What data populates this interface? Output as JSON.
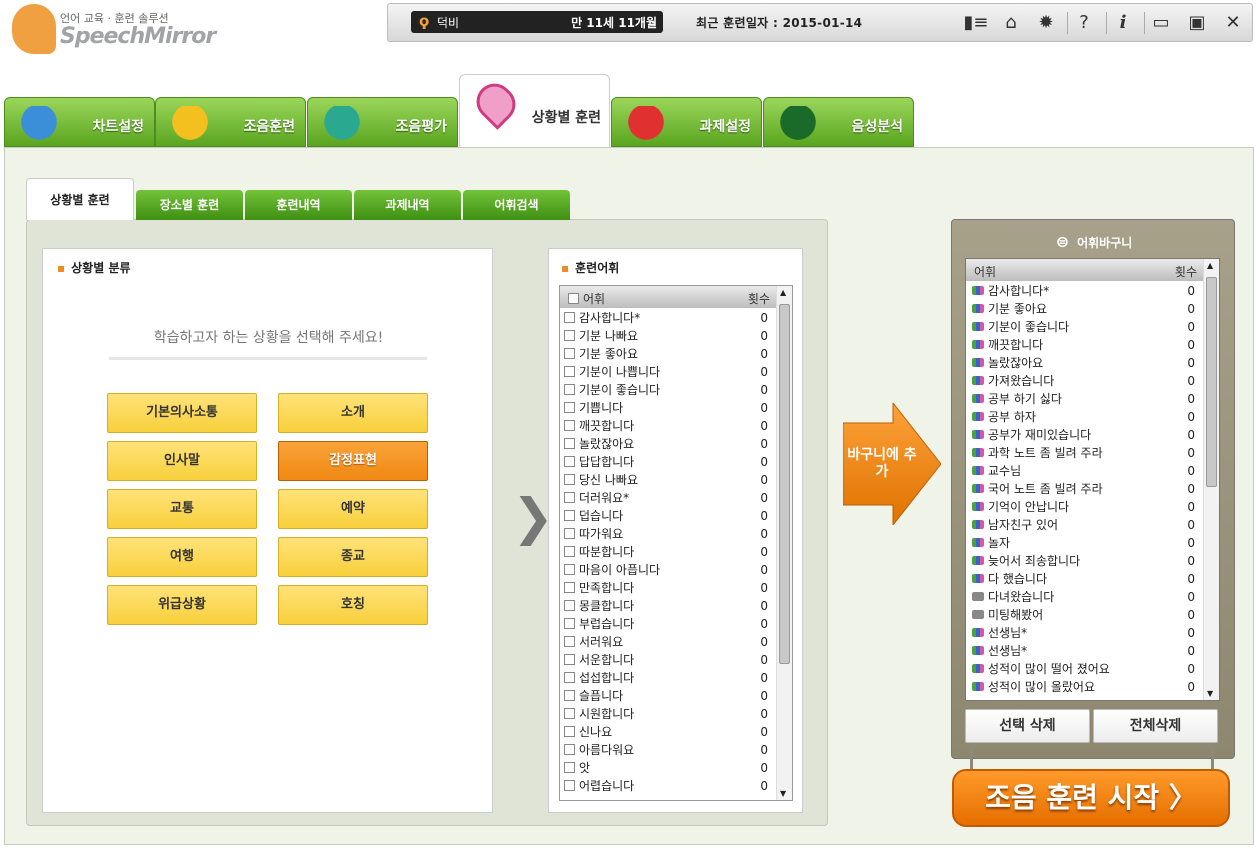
{
  "logo": {
    "sub": "언어 교육 · 훈련 솔루션",
    "main": "SpeechMirror"
  },
  "user": {
    "name": "덕비",
    "age": "만 11세 11개월",
    "last_training": "최근 훈련일자 : 2015-01-14"
  },
  "toolbar_icons": [
    "id-card-icon",
    "home-icon",
    "gear-icon",
    "help-icon",
    "info-icon",
    "minimize-icon",
    "restore-icon",
    "close-icon"
  ],
  "toolbar_glyphs": [
    "▮≡",
    "⌂",
    "✹",
    "?",
    "i",
    "▭",
    "▣",
    "✕"
  ],
  "main_tabs": [
    {
      "label": "차트설정",
      "icon": "chart-person-icon"
    },
    {
      "label": "조음훈련",
      "icon": "speaking-face-icon"
    },
    {
      "label": "조음평가",
      "icon": "ox-icon"
    },
    {
      "label": "상황별 훈련",
      "icon": "map-pin-icon"
    },
    {
      "label": "과제설정",
      "icon": "rubiks-cube-icon"
    },
    {
      "label": "음성분석",
      "icon": "waveform-monitor-icon"
    }
  ],
  "sub_tabs": [
    "상황별 훈련",
    "장소별 훈련",
    "훈련내역",
    "과제내역",
    "어휘검색"
  ],
  "category": {
    "title": "상황별 분류",
    "hint": "학습하고자 하는 상황을 선택해 주세요!",
    "buttons": [
      "기본의사소통",
      "소개",
      "인사말",
      "감정표현",
      "교통",
      "예약",
      "여행",
      "종교",
      "위급상황",
      "호칭"
    ],
    "selected": "감정표현"
  },
  "vocab": {
    "title": "훈련어휘",
    "col_word": "어휘",
    "col_count": "횟수",
    "rows": [
      {
        "w": "감사합니다*",
        "c": "0"
      },
      {
        "w": "기분 나빠요",
        "c": "0"
      },
      {
        "w": "기분 좋아요",
        "c": "0"
      },
      {
        "w": "기분이 나쁩니다",
        "c": "0"
      },
      {
        "w": "기분이 좋습니다",
        "c": "0"
      },
      {
        "w": "기쁩니다",
        "c": "0"
      },
      {
        "w": "깨끗합니다",
        "c": "0"
      },
      {
        "w": "놀랐잖아요",
        "c": "0"
      },
      {
        "w": "답답합니다",
        "c": "0"
      },
      {
        "w": "당신 나빠요",
        "c": "0"
      },
      {
        "w": "더러워요*",
        "c": "0"
      },
      {
        "w": "덥습니다",
        "c": "0"
      },
      {
        "w": "따가워요",
        "c": "0"
      },
      {
        "w": "따분합니다",
        "c": "0"
      },
      {
        "w": "마음이 아픕니다",
        "c": "0"
      },
      {
        "w": "만족합니다",
        "c": "0"
      },
      {
        "w": "몽클합니다",
        "c": "0"
      },
      {
        "w": "부럽습니다",
        "c": "0"
      },
      {
        "w": "서러워요",
        "c": "0"
      },
      {
        "w": "서운합니다",
        "c": "0"
      },
      {
        "w": "섭섭합니다",
        "c": "0"
      },
      {
        "w": "슬픕니다",
        "c": "0"
      },
      {
        "w": "시원합니다",
        "c": "0"
      },
      {
        "w": "신나요",
        "c": "0"
      },
      {
        "w": "아름다워요",
        "c": "0"
      },
      {
        "w": "앗",
        "c": "0"
      },
      {
        "w": "어렵습니다",
        "c": "0"
      }
    ]
  },
  "add_button": "바구니에 추가",
  "basket": {
    "title": "어휘바구니",
    "col_word": "어휘",
    "col_count": "횟수",
    "rows": [
      {
        "w": "감사합니다*",
        "c": "0",
        "gray": false
      },
      {
        "w": "기분 좋아요",
        "c": "0",
        "gray": false
      },
      {
        "w": "기분이 좋습니다",
        "c": "0",
        "gray": false
      },
      {
        "w": "깨끗합니다",
        "c": "0",
        "gray": false
      },
      {
        "w": "놀랐잖아요",
        "c": "0",
        "gray": false
      },
      {
        "w": "가져왔습니다",
        "c": "0",
        "gray": false
      },
      {
        "w": "공부 하기 싫다",
        "c": "0",
        "gray": false
      },
      {
        "w": "공부 하자",
        "c": "0",
        "gray": false
      },
      {
        "w": "공부가 재미있습니다",
        "c": "0",
        "gray": false
      },
      {
        "w": "과학 노트 좀 빌려 주라",
        "c": "0",
        "gray": false
      },
      {
        "w": "교수님",
        "c": "0",
        "gray": false
      },
      {
        "w": "국어 노트 좀 빌려 주라",
        "c": "0",
        "gray": false
      },
      {
        "w": "기억이 안납니다",
        "c": "0",
        "gray": false
      },
      {
        "w": "남자친구 있어",
        "c": "0",
        "gray": false
      },
      {
        "w": "놀자",
        "c": "0",
        "gray": false
      },
      {
        "w": "늦어서 죄송합니다",
        "c": "0",
        "gray": false
      },
      {
        "w": "다 했습니다",
        "c": "0",
        "gray": false
      },
      {
        "w": "다녀왔습니다",
        "c": "0",
        "gray": true
      },
      {
        "w": "미팅해봤어",
        "c": "0",
        "gray": true
      },
      {
        "w": "선생님*",
        "c": "0",
        "gray": false
      },
      {
        "w": "선생님*",
        "c": "0",
        "gray": false
      },
      {
        "w": "성적이 많이 떨어 졌어요",
        "c": "0",
        "gray": false
      },
      {
        "w": "성적이 많이 올랐어요",
        "c": "0",
        "gray": false
      }
    ],
    "delete_selected": "선택 삭제",
    "delete_all": "전체삭제"
  },
  "start_button": "조음 훈련 시작 〉"
}
